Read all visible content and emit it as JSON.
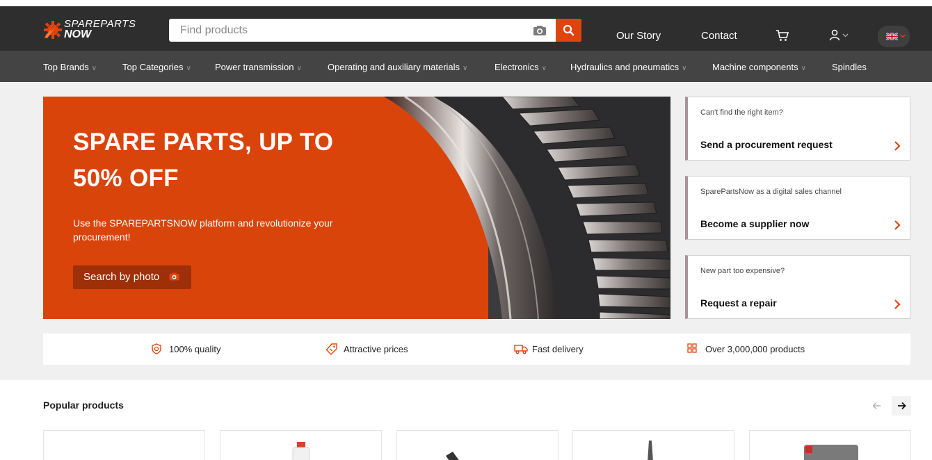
{
  "header": {
    "logo_line1": "SPAREPARTS",
    "logo_line2": "NOW",
    "search_placeholder": "Find products",
    "links": [
      "Our Story",
      "Contact"
    ]
  },
  "categories": [
    "Top Brands",
    "Top Categories",
    "Power transmission",
    "Operating and auxiliary materials",
    "Electronics",
    "Hydraulics and pneumatics",
    "Machine components",
    "Spindles"
  ],
  "hero": {
    "title": "SPARE PARTS, UP TO 50% OFF",
    "subtitle": "Use the SPAREPARTSNOW platform and revolutionize your procurement!",
    "button": "Search by photo"
  },
  "cards": [
    {
      "sub": "Can't find the right item?",
      "main": "Send a procurement request"
    },
    {
      "sub": "SparePartsNow as a digital sales channel",
      "main": "Become a supplier now"
    },
    {
      "sub": "New part too expensive?",
      "main": "Request a repair"
    }
  ],
  "usps": [
    "100% quality",
    "Attractive prices",
    "Fast delivery",
    "Over 3,000,000 products"
  ],
  "popular": {
    "title": "Popular products"
  },
  "colors": {
    "accent": "#e0440e",
    "hero": "#d9440a",
    "header": "#2e2e2e",
    "nav": "#444444"
  }
}
